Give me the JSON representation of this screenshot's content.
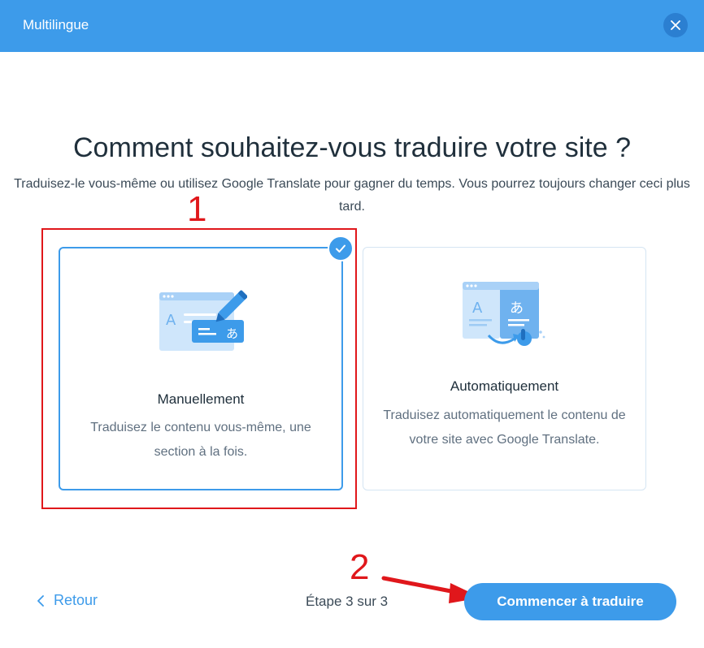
{
  "header": {
    "title": "Multilingue"
  },
  "main": {
    "title": "Comment souhaitez-vous traduire votre site ?",
    "subtitle": "Traduisez-le vous-même ou utilisez Google Translate pour gagner du temps. Vous pourrez toujours changer ceci plus tard.",
    "options": [
      {
        "title": "Manuellement",
        "description": "Traduisez le contenu vous-même, une section à la fois.",
        "selected": true,
        "icon": "manual-translate-illustration"
      },
      {
        "title": "Automatiquement",
        "description": "Traduisez automatiquement le contenu de votre site avec Google Translate.",
        "selected": false,
        "icon": "auto-translate-illustration"
      }
    ]
  },
  "annotations": {
    "first": "1",
    "second": "2"
  },
  "footer": {
    "back_label": "Retour",
    "step_text": "Étape 3 sur 3",
    "primary_label": "Commencer à traduire"
  },
  "colors": {
    "accent": "#3d9bea",
    "annotation": "#e0171b",
    "text": "#20303c"
  }
}
